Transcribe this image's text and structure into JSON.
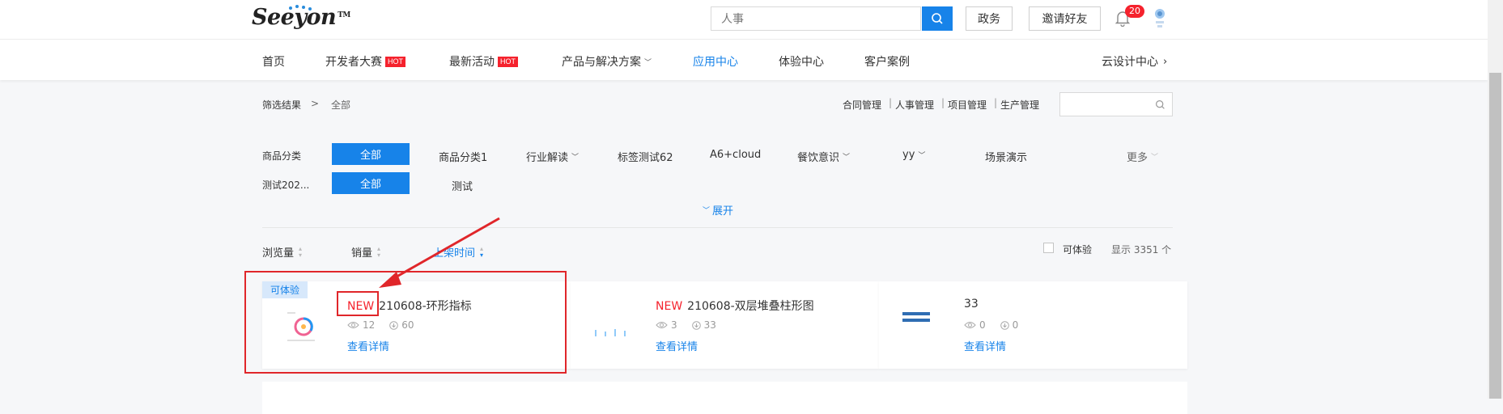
{
  "header": {
    "logo_text": "Seeyon",
    "logo_tm": "TM",
    "search_placeholder": "人事",
    "btn_gov": "政务",
    "btn_invite": "邀请好友",
    "notification_count": "20"
  },
  "nav": {
    "items": [
      {
        "label": "首页"
      },
      {
        "label": "开发者大赛",
        "badge": "HOT"
      },
      {
        "label": "最新活动",
        "badge": "HOT"
      },
      {
        "label": "产品与解决方案"
      },
      {
        "label": "应用中心"
      },
      {
        "label": "体验中心"
      },
      {
        "label": "客户案例"
      }
    ],
    "right": "云设计中心"
  },
  "breadcrumb": {
    "label": "筛选结果",
    "sep": ">",
    "current": "全部"
  },
  "quick_links": [
    "合同管理",
    "人事管理",
    "项目管理",
    "生产管理"
  ],
  "filters": {
    "row1_label": "商品分类",
    "row1_active": "全部",
    "row1_items": [
      "商品分类1",
      "行业解读",
      "标签测试62",
      "A6+cloud",
      "餐饮意识",
      "yy",
      "场景演示"
    ],
    "more": "更多",
    "row2_label": "测试202...",
    "row2_active": "全部",
    "row2_items": [
      "测试"
    ],
    "expand": "展开"
  },
  "sort": {
    "views": "浏览量",
    "sales": "销量",
    "time": "上架时间",
    "trial_checkbox": "可体验",
    "count_label": "显示 3351 个"
  },
  "cards": [
    {
      "badge": "可体验",
      "new": "NEW",
      "title": "210608-环形指标",
      "views": "12",
      "downloads": "60",
      "detail": "查看详情"
    },
    {
      "new": "NEW",
      "title": "210608-双层堆叠柱形图",
      "views": "3",
      "downloads": "33",
      "detail": "查看详情"
    },
    {
      "title": "33",
      "views": "0",
      "downloads": "0",
      "detail": "查看详情"
    }
  ],
  "colors": {
    "accent": "#1783e9",
    "hot": "#f5222d",
    "annotation": "#e0262a"
  }
}
